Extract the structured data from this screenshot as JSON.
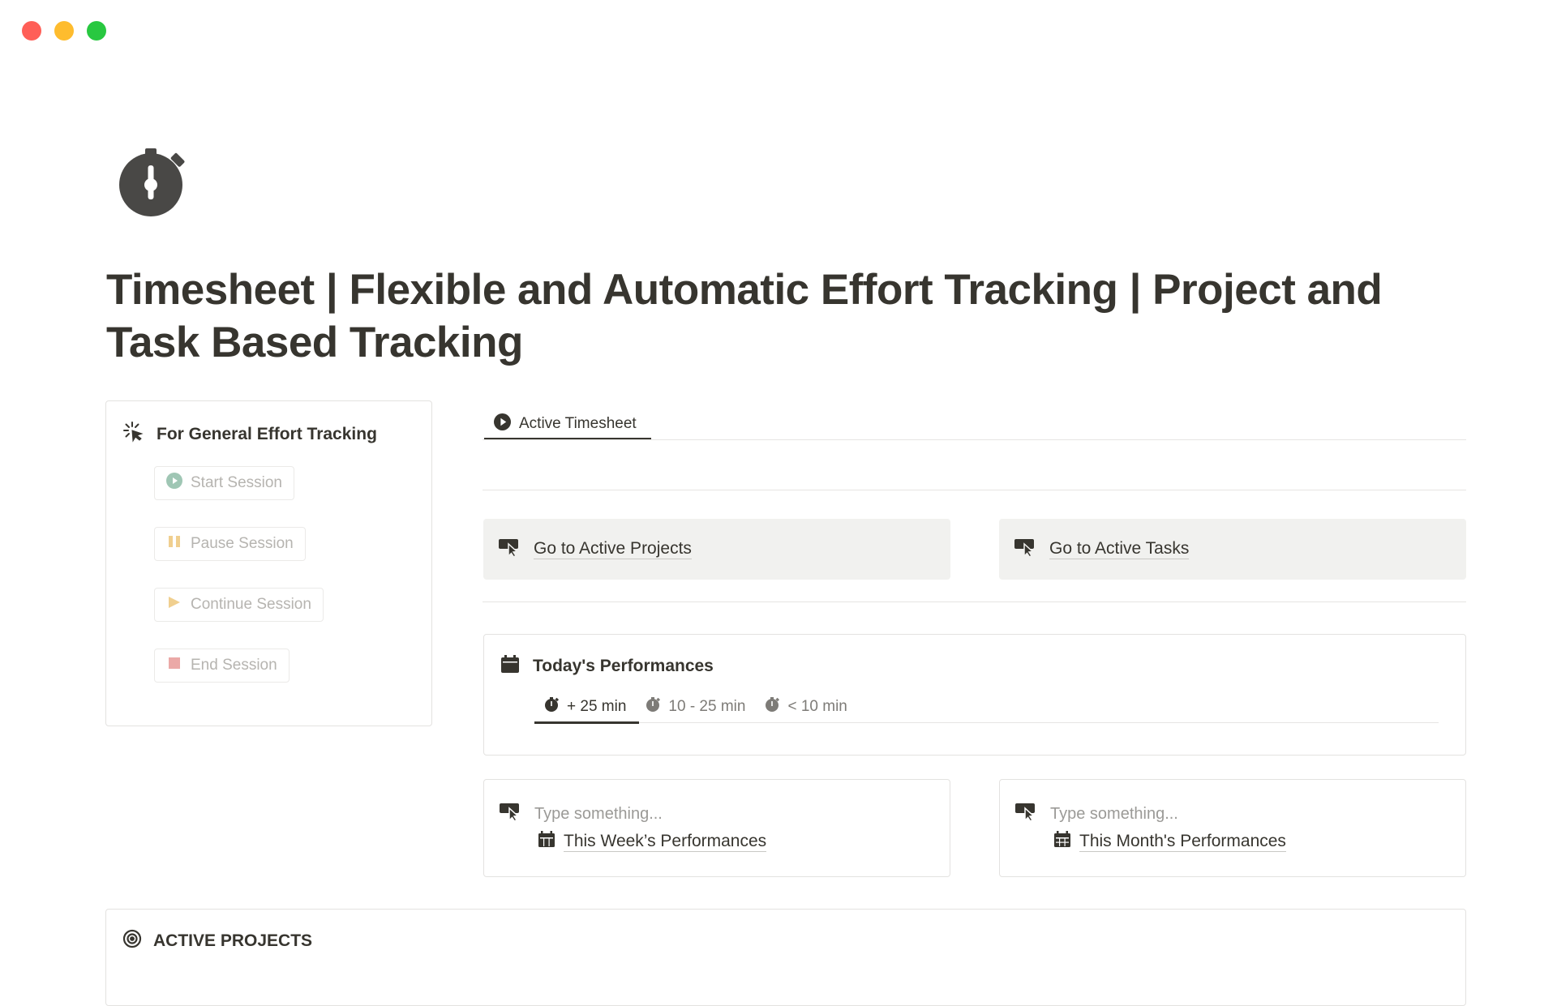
{
  "window": {
    "controls": [
      {
        "name": "close",
        "color": "#ff5f57"
      },
      {
        "name": "minimize",
        "color": "#febc2e"
      },
      {
        "name": "zoom",
        "color": "#28c840"
      }
    ]
  },
  "page": {
    "icon": "stopwatch-icon",
    "title": "Timesheet | Flexible and Automatic Effort Tracking | Project and Task Based Tracking"
  },
  "general_tracking": {
    "title": "For General Effort Tracking",
    "icon": "click-sparkle-icon",
    "buttons": [
      {
        "label": "Start Session",
        "icon": "play-circle-icon",
        "color": "#9fc6b4"
      },
      {
        "label": "Pause Session",
        "icon": "pause-icon",
        "color": "#f0cf8f"
      },
      {
        "label": "Continue Session",
        "icon": "play-icon",
        "color": "#f0cf8f"
      },
      {
        "label": "End Session",
        "icon": "stop-icon",
        "color": "#eba9a7"
      }
    ]
  },
  "tabs": [
    {
      "label": "Active Timesheet",
      "icon": "play-circle-icon",
      "active": true
    }
  ],
  "links": {
    "projects": {
      "label": "Go to Active Projects",
      "icon": "pointer-icon"
    },
    "tasks": {
      "label": "Go to Active Tasks",
      "icon": "pointer-icon"
    }
  },
  "today": {
    "title": "Today's Performances",
    "icon": "calendar-icon",
    "filters": [
      {
        "label": "+ 25 min",
        "icon": "stopwatch-icon",
        "active": true
      },
      {
        "label": "10 - 25 min",
        "icon": "stopwatch-icon",
        "active": false
      },
      {
        "label": "< 10 min",
        "icon": "stopwatch-icon",
        "active": false
      }
    ]
  },
  "week": {
    "placeholder": "Type something...",
    "link": "This Week’s Performances",
    "icon": "calendar-week-icon"
  },
  "month": {
    "placeholder": "Type something...",
    "link": "This Month's Performances",
    "icon": "calendar-month-icon"
  },
  "active_projects": {
    "title": "ACTIVE PROJECTS",
    "icon": "target-icon"
  },
  "colors": {
    "text": "#37352f",
    "muted": "#9b9a97",
    "border": "#e3e2e0",
    "link_bg": "#f1f1ef"
  }
}
